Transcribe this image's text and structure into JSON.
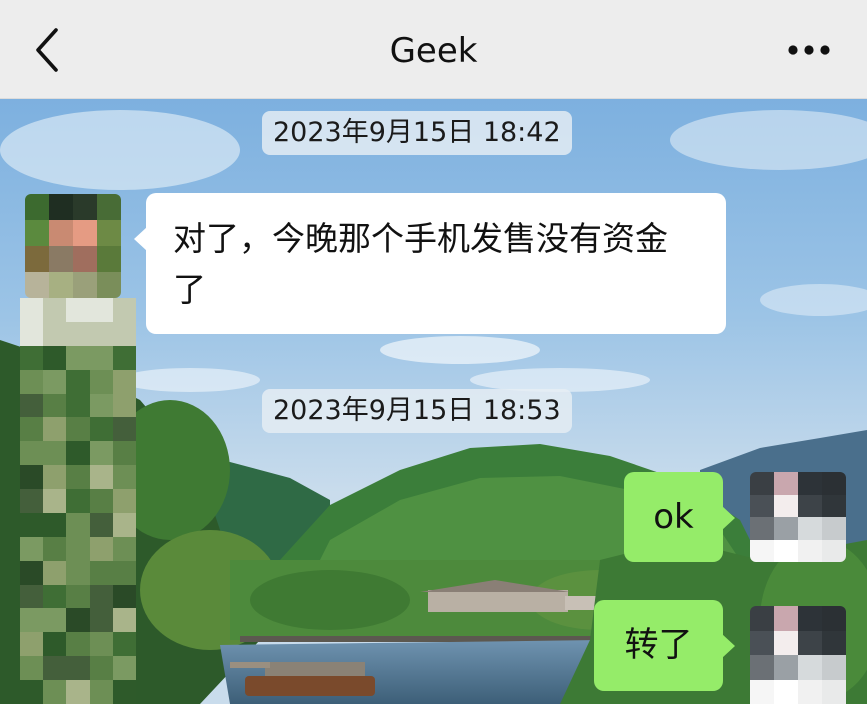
{
  "header": {
    "title": "Geek",
    "back_icon": "chevron-left-icon",
    "more_icon": "more-horizontal-icon"
  },
  "messages": [
    {
      "type": "timestamp",
      "text": "2023年9月15日 18:42"
    },
    {
      "type": "incoming",
      "text": "对了，今晚那个手机发售没有资金了"
    },
    {
      "type": "timestamp",
      "text": "2023年9月15日 18:53"
    },
    {
      "type": "outgoing",
      "text": "ok"
    },
    {
      "type": "outgoing",
      "text": "转了"
    }
  ],
  "colors": {
    "navbar_bg": "#ededed",
    "incoming_bubble": "#ffffff",
    "outgoing_bubble": "#95ec69",
    "timestamp_bg": "#e6eef4"
  }
}
